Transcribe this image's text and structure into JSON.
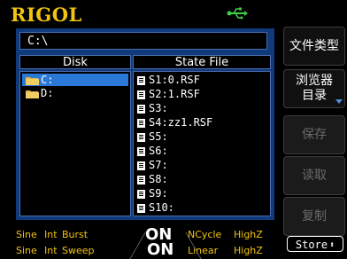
{
  "brand": {
    "logo": "RIGOL"
  },
  "browser": {
    "path": "C:\\",
    "disk_header": "Disk",
    "state_header": "State File",
    "disks": [
      {
        "label": "C:",
        "selected": true
      },
      {
        "label": "D:",
        "selected": false
      }
    ],
    "state_files": [
      "S1:0.RSF",
      "S2:1.RSF",
      "S3:",
      "S4:zz1.RSF",
      "S5:",
      "S6:",
      "S7:",
      "S8:",
      "S9:",
      "S10:"
    ]
  },
  "menu": {
    "file_type": "文件类型",
    "browse_line1": "浏览器",
    "browse_line2": "目录",
    "save": "保存",
    "read": "读取",
    "copy": "复制",
    "store": "Store"
  },
  "status": {
    "ch1": {
      "wave": "Sine",
      "source": "Int",
      "mode": "Burst",
      "state": "ON",
      "burst": "NCycle",
      "load": "HighZ"
    },
    "ch2": {
      "wave": "Sine",
      "source": "Int",
      "mode": "Sweep",
      "state": "ON",
      "sweep": "Linear",
      "load": "HighZ"
    }
  },
  "colors": {
    "accent_yellow": "#f1c40f",
    "selection_blue": "#2a78d8",
    "panel_blue": "#103a7a",
    "usb_green": "#3ecf4a"
  },
  "icons": {
    "usb": "usb-icon",
    "folder": "folder-icon",
    "file": "file-icon"
  }
}
